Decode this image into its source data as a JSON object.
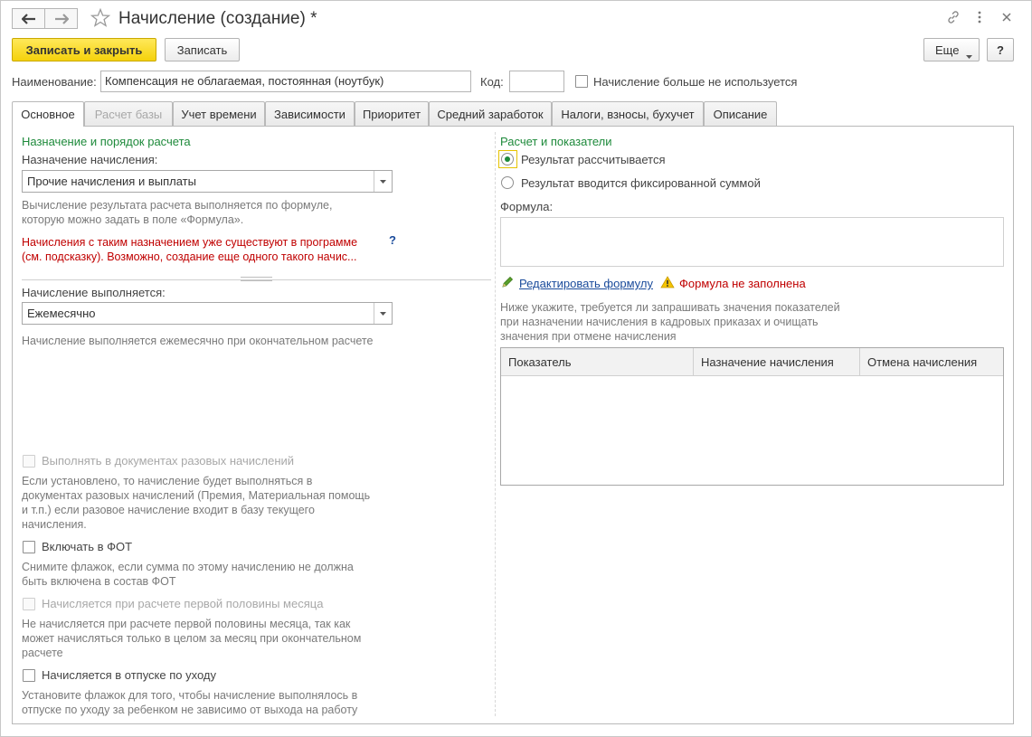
{
  "window": {
    "title": "Начисление (создание) *"
  },
  "toolbar": {
    "save_close_label": "Записать и закрыть",
    "save_label": "Записать",
    "more_label": "Еще",
    "help_label": "?"
  },
  "header": {
    "name_label": "Наименование:",
    "name_value": "Компенсация не облагаемая, постоянная (ноутбук)",
    "code_label": "Код:",
    "code_value": "",
    "unused_label": "Начисление больше не используется"
  },
  "tabs": [
    {
      "label": "Основное"
    },
    {
      "label": "Расчет базы"
    },
    {
      "label": "Учет времени"
    },
    {
      "label": "Зависимости"
    },
    {
      "label": "Приоритет"
    },
    {
      "label": "Средний заработок"
    },
    {
      "label": "Налоги, взносы, бухучет"
    },
    {
      "label": "Описание"
    }
  ],
  "left": {
    "group_title": "Назначение и порядок расчета",
    "purpose_label": "Назначение начисления:",
    "purpose_value": "Прочие начисления и выплаты",
    "purpose_hint_1": "Вычисление результата расчета выполняется по формуле,",
    "purpose_hint_2": "которую можно задать в поле «Формула».",
    "warning_1": "Начисления с таким назначением уже существуют в программе",
    "warning_2": "(см. подсказку). Возможно, создание еще одного такого начис...",
    "warning_help": "?",
    "exec_label": "Начисление выполняется:",
    "exec_value": "Ежемесячно",
    "exec_hint": "Начисление выполняется ежемесячно при окончательном расчете",
    "one_time_label": "Выполнять в документах разовых начислений",
    "one_time_hint_1": "Если установлено, то начисление будет выполняться в",
    "one_time_hint_2": "документах разовых начислений (Премия, Материальная помощь",
    "one_time_hint_3": "и т.п.) если разовое начисление входит в базу текущего",
    "one_time_hint_4": "начисления.",
    "fot_label": "Включать в ФОТ",
    "fot_hint_1": "Снимите флажок, если сумма по этому начислению не должна",
    "fot_hint_2": "быть включена в состав ФОТ",
    "half_label": "Начисляется при расчете первой половины месяца",
    "half_hint_1": "Не начисляется при расчете первой половины месяца, так как",
    "half_hint_2": "может начисляться только в целом за месяц при окончательном",
    "half_hint_3": "расчете",
    "leave_label": "Начисляется в отпуске по уходу",
    "leave_hint_1": "Установите флажок для того, чтобы начисление выполнялось в",
    "leave_hint_2": "отпуске по уходу за ребенком не зависимо от выхода на работу"
  },
  "right": {
    "group_title": "Расчет и показатели",
    "radio_calc_label": "Результат рассчитывается",
    "radio_fixed_label": "Результат вводится фиксированной суммой",
    "formula_label": "Формула:",
    "formula_value": "",
    "edit_formula_link": "Редактировать формулу",
    "formula_warning": "Формула не заполнена",
    "indicators_hint_1": "Ниже укажите, требуется ли запрашивать значения показателей",
    "indicators_hint_2": "при назначении начисления в кадровых приказах и очищать",
    "indicators_hint_3": "значения при отмене начисления",
    "table_headers": [
      "Показатель",
      "Назначение начисления",
      "Отмена начисления"
    ]
  },
  "colors": {
    "accent_green": "#1e8a3b",
    "warning_red": "#c00000",
    "primary_button": "#f5d20b",
    "link_blue": "#1a4b9b"
  }
}
